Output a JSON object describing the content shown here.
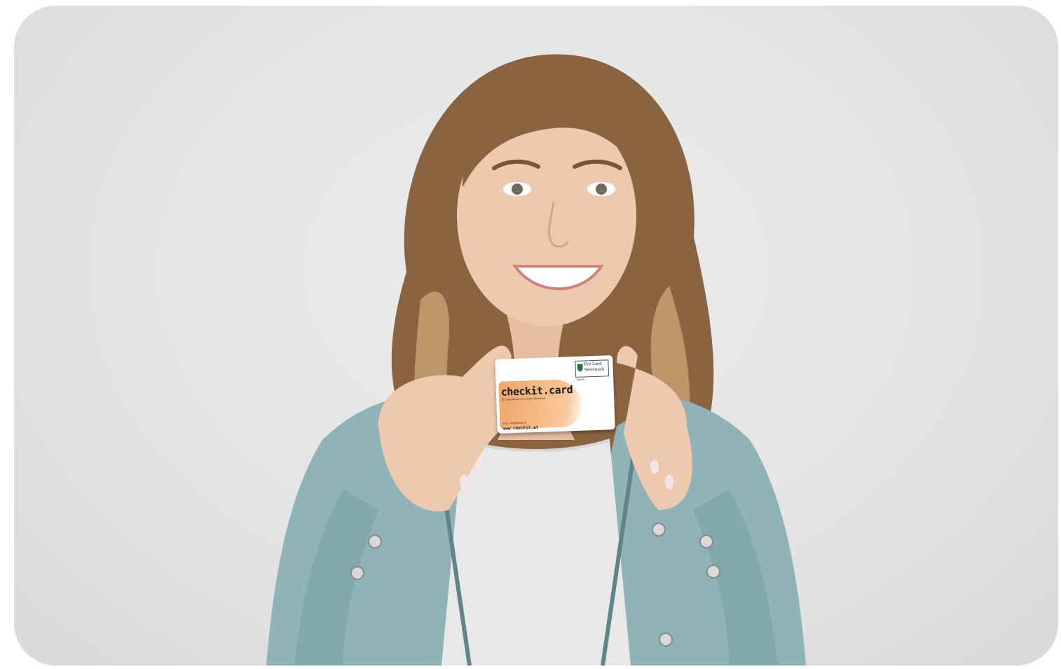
{
  "photo": {
    "subject": "young-woman-holding-card",
    "colors": {
      "background": "#e6e6e6",
      "hair": "#8a6440",
      "jacket": "#8fb3b6",
      "top": "#e8e8e8",
      "skin": "#eec9b0",
      "accent_orange": "#f0a66a"
    }
  },
  "card": {
    "title": "checkit.card",
    "tagline": "die Jugendkarte des Landes Steiermark",
    "infos": "Infos: info@checkit.at",
    "url": "www.checkit.at",
    "logo_line1": "Das Land",
    "logo_line2": "Steiermark",
    "logo_sub": "Jugend"
  }
}
